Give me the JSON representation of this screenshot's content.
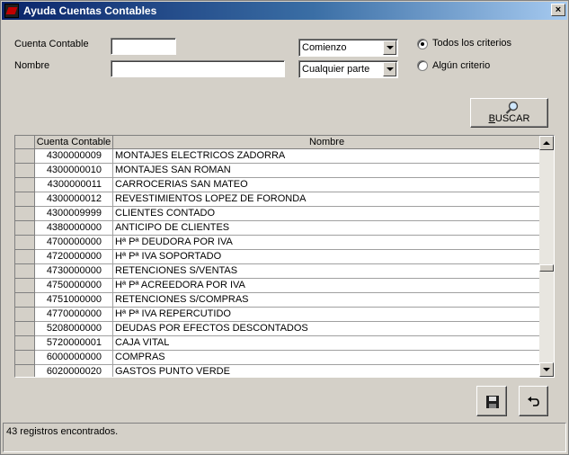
{
  "window": {
    "title": "Ayuda Cuentas Contables",
    "close_label": "×"
  },
  "form": {
    "cuenta_label": "Cuenta Contable",
    "cuenta_value": "",
    "nombre_label": "Nombre",
    "nombre_value": "",
    "match_cuenta": "Comienzo",
    "match_nombre": "Cualquier parte",
    "radio_todos": "Todos los criterios",
    "radio_alguno": "Algún criterio",
    "selected_radio": "todos"
  },
  "buscar_label_first": "B",
  "buscar_label_rest": "USCAR",
  "table": {
    "headers": [
      "Cuenta Contable",
      "Nombre"
    ],
    "rows": [
      [
        "4300000009",
        "MONTAJES ELECTRICOS ZADORRA"
      ],
      [
        "4300000010",
        "MONTAJES SAN ROMAN"
      ],
      [
        "4300000011",
        "CARROCERIAS SAN MATEO"
      ],
      [
        "4300000012",
        "REVESTIMIENTOS LOPEZ DE FORONDA"
      ],
      [
        "4300009999",
        "CLIENTES CONTADO"
      ],
      [
        "4380000000",
        "ANTICIPO DE CLIENTES"
      ],
      [
        "4700000000",
        "Hª Pª DEUDORA POR IVA"
      ],
      [
        "4720000000",
        "Hª Pª IVA SOPORTADO"
      ],
      [
        "4730000000",
        "RETENCIONES S/VENTAS"
      ],
      [
        "4750000000",
        "Hª Pª ACREEDORA POR IVA"
      ],
      [
        "4751000000",
        "RETENCIONES S/COMPRAS"
      ],
      [
        "4770000000",
        "Hª Pª IVA REPERCUTIDO"
      ],
      [
        "5208000000",
        "DEUDAS POR EFECTOS DESCONTADOS"
      ],
      [
        "5720000001",
        "CAJA VITAL"
      ],
      [
        "6000000000",
        "COMPRAS"
      ],
      [
        "6020000020",
        "GASTOS PUNTO VERDE"
      ]
    ]
  },
  "icons": {
    "save": "save-icon",
    "undo": "undo-icon",
    "search": "magnifier-icon"
  },
  "status_text": "43 registros encontrados.",
  "colors": {
    "title_start": "#0a246a",
    "title_end": "#a6caf0",
    "face": "#d4d0c8"
  }
}
